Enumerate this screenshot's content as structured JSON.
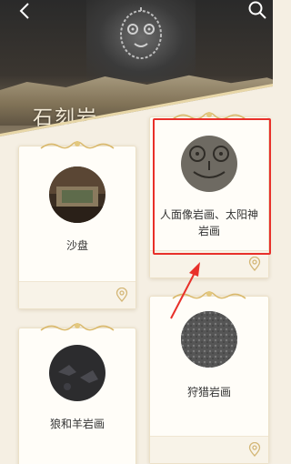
{
  "hero": {
    "title": "石刻岩"
  },
  "nav": {
    "back_icon": "chevron-left-icon",
    "search_icon": "search-icon"
  },
  "cards": [
    {
      "label": "沙盘",
      "thumb": "sand-table-photo",
      "pin_icon": "location-pin-icon"
    },
    {
      "label": "人面像岩画、太阳神岩画",
      "thumb": "face-petroglyph-photo",
      "pin_icon": "location-pin-icon"
    },
    {
      "label": "狼和羊岩画",
      "thumb": "wolf-sheep-petroglyph-photo",
      "pin_icon": "location-pin-icon"
    },
    {
      "label": "狩猎岩画",
      "thumb": "hunting-petroglyph-photo",
      "pin_icon": "location-pin-icon"
    }
  ],
  "colors": {
    "background": "#f5efe3",
    "accent_gold": "#d9b86a",
    "highlight_red": "#e8302a"
  }
}
